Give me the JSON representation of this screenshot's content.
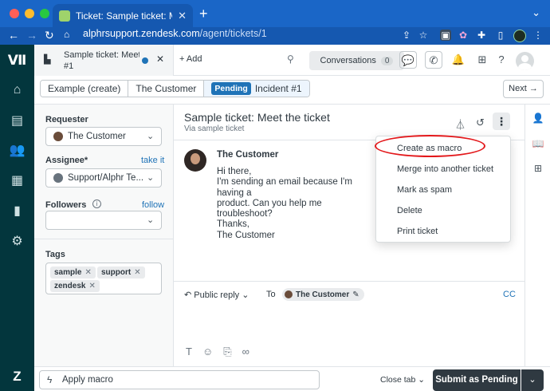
{
  "browser": {
    "tab_title": "Ticket: Sample ticket: Meet the",
    "new_tab": "+",
    "url_host": "alphrsupport.zendesk.com",
    "url_path": "/agent/tickets/1"
  },
  "header": {
    "ticket_tab_title": "Sample ticket: Meet the",
    "ticket_tab_number": "#1",
    "add_label": "+ Add",
    "conversations_label": "Conversations",
    "conversations_count": "0"
  },
  "breadcrumbs": {
    "items": [
      "Example (create)",
      "The Customer"
    ],
    "status": "Pending",
    "incident": "Incident #1",
    "next_label": "Next"
  },
  "properties": {
    "requester_label": "Requester",
    "requester_value": "The Customer",
    "assignee_label": "Assignee*",
    "assignee_link": "take it",
    "assignee_value": "Support/Alphr Te...",
    "followers_label": "Followers",
    "followers_link": "follow",
    "tags_label": "Tags",
    "tags": [
      "sample",
      "support",
      "zendesk"
    ]
  },
  "ticket": {
    "subject": "Sample ticket: Meet the ticket",
    "via": "Via sample ticket",
    "author": "The Customer",
    "message": "Hi there,\nI'm sending an email because I'm having a\nproduct. Can you help me troubleshoot?\nThanks,\nThe Customer"
  },
  "reply": {
    "type_label": "Public reply",
    "to_label": "To",
    "recipient": "The Customer",
    "cc_label": "CC"
  },
  "menu": {
    "items": [
      "Create as macro",
      "Merge into another ticket",
      "Mark as spam",
      "Delete",
      "Print ticket"
    ]
  },
  "footer": {
    "apply_macro": "Apply macro",
    "close_tab": "Close tab",
    "submit": "Submit as Pending"
  },
  "colors": {
    "browser_accent": "#1a66c7",
    "rail": "#03363d",
    "pending_badge": "#1f73b7",
    "submit_button": "#2f3941",
    "highlight": "#e3181b"
  }
}
